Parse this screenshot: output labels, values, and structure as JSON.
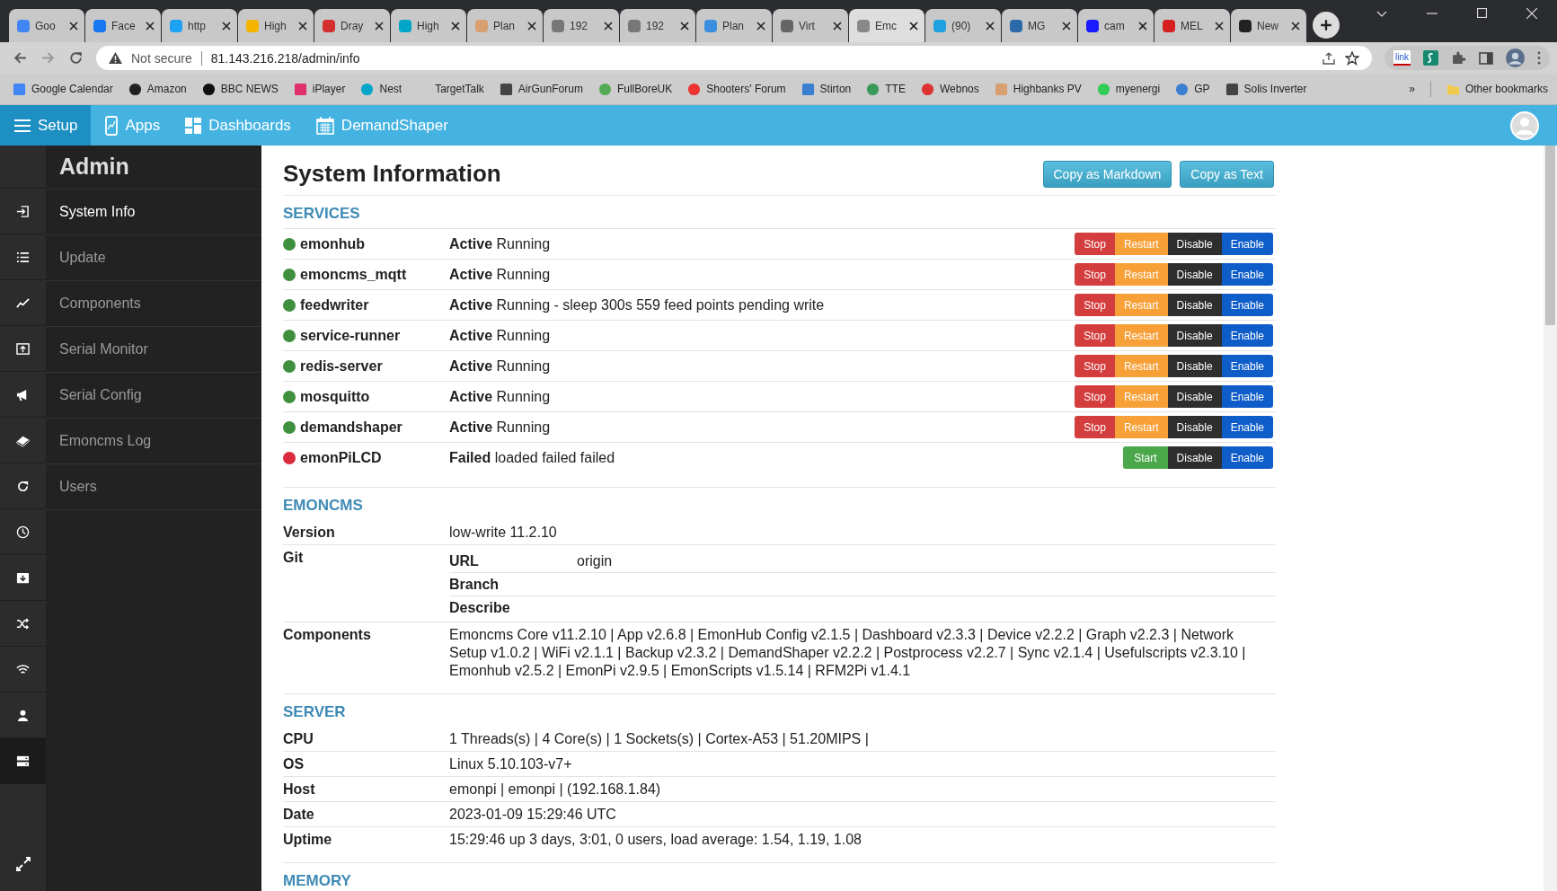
{
  "browser": {
    "tabs": [
      {
        "title": "Goo",
        "selected": false
      },
      {
        "title": "Face",
        "selected": false
      },
      {
        "title": "http",
        "selected": false
      },
      {
        "title": "High",
        "selected": false
      },
      {
        "title": "Dray",
        "selected": false
      },
      {
        "title": "High",
        "selected": false
      },
      {
        "title": "Plan",
        "selected": false
      },
      {
        "title": "192",
        "selected": false
      },
      {
        "title": "192",
        "selected": false
      },
      {
        "title": "Plan",
        "selected": false
      },
      {
        "title": "Virt",
        "selected": false
      },
      {
        "title": "Emc",
        "selected": true
      },
      {
        "title": "(90)",
        "selected": false
      },
      {
        "title": "MG",
        "selected": false
      },
      {
        "title": "cam",
        "selected": false
      },
      {
        "title": "MEL",
        "selected": false
      },
      {
        "title": "New",
        "selected": false
      }
    ],
    "security": "Not secure",
    "url": "81.143.216.218/admin/info",
    "extension_label": "link",
    "bookmarks": [
      "Google Calendar",
      "Amazon",
      "BBC NEWS",
      "iPlayer",
      "Nest",
      "TargetTalk",
      "AirGunForum",
      "FullBoreUK",
      "Shooters' Forum",
      "Stirton",
      "TTE",
      "Webnos",
      "Highbanks PV",
      "myenergi",
      "GP",
      "Solis Inverter"
    ],
    "bookmarks_overflow": "»",
    "other_bookmarks": "Other bookmarks"
  },
  "navbar": {
    "items": [
      {
        "label": "Setup",
        "selected": true
      },
      {
        "label": "Apps",
        "selected": false
      },
      {
        "label": "Dashboards",
        "selected": false
      },
      {
        "label": "DemandShaper",
        "selected": false
      }
    ]
  },
  "sidebar": {
    "title": "Admin",
    "items": [
      {
        "label": "System Info",
        "selected": true
      },
      {
        "label": "Update",
        "selected": false
      },
      {
        "label": "Components",
        "selected": false
      },
      {
        "label": "Serial Monitor",
        "selected": false
      },
      {
        "label": "Serial Config",
        "selected": false
      },
      {
        "label": "Emoncms Log",
        "selected": false
      },
      {
        "label": "Users",
        "selected": false
      }
    ]
  },
  "page": {
    "title": "System Information",
    "buttons": [
      "Copy as Markdown",
      "Copy as Text"
    ],
    "services": {
      "heading": "SERVICES",
      "rows": [
        {
          "name": "emonhub",
          "color": "#3f8f3f",
          "status": "**Active** Running",
          "actions": [
            {
              "label": "Stop",
              "kind": "stop"
            },
            {
              "label": "Restart",
              "kind": "restart"
            },
            {
              "label": "Disable",
              "kind": "disable"
            },
            {
              "label": "Enable",
              "kind": "enable"
            }
          ]
        },
        {
          "name": "emoncms_mqtt",
          "color": "#3f8f3f",
          "status": "**Active** Running",
          "actions": [
            {
              "label": "Stop",
              "kind": "stop"
            },
            {
              "label": "Restart",
              "kind": "restart"
            },
            {
              "label": "Disable",
              "kind": "disable"
            },
            {
              "label": "Enable",
              "kind": "enable"
            }
          ]
        },
        {
          "name": "feedwriter",
          "color": "#3f8f3f",
          "status": "**Active** Running - sleep 300s 559 feed points pending write",
          "actions": [
            {
              "label": "Stop",
              "kind": "stop"
            },
            {
              "label": "Restart",
              "kind": "restart"
            },
            {
              "label": "Disable",
              "kind": "disable"
            },
            {
              "label": "Enable",
              "kind": "enable"
            }
          ]
        },
        {
          "name": "service-runner",
          "color": "#3f8f3f",
          "status": "**Active** Running",
          "actions": [
            {
              "label": "Stop",
              "kind": "stop"
            },
            {
              "label": "Restart",
              "kind": "restart"
            },
            {
              "label": "Disable",
              "kind": "disable"
            },
            {
              "label": "Enable",
              "kind": "enable"
            }
          ]
        },
        {
          "name": "redis-server",
          "color": "#3f8f3f",
          "status": "**Active** Running",
          "actions": [
            {
              "label": "Stop",
              "kind": "stop"
            },
            {
              "label": "Restart",
              "kind": "restart"
            },
            {
              "label": "Disable",
              "kind": "disable"
            },
            {
              "label": "Enable",
              "kind": "enable"
            }
          ]
        },
        {
          "name": "mosquitto",
          "color": "#3f8f3f",
          "status": "**Active** Running",
          "actions": [
            {
              "label": "Stop",
              "kind": "stop"
            },
            {
              "label": "Restart",
              "kind": "restart"
            },
            {
              "label": "Disable",
              "kind": "disable"
            },
            {
              "label": "Enable",
              "kind": "enable"
            }
          ]
        },
        {
          "name": "demandshaper",
          "color": "#3f8f3f",
          "status": "**Active** Running",
          "actions": [
            {
              "label": "Stop",
              "kind": "stop"
            },
            {
              "label": "Restart",
              "kind": "restart"
            },
            {
              "label": "Disable",
              "kind": "disable"
            },
            {
              "label": "Enable",
              "kind": "enable"
            }
          ]
        },
        {
          "name": "emonPiLCD",
          "color": "#dc2b3e",
          "status": "**Failed** loaded failed failed",
          "actions": [
            {
              "label": "Start",
              "kind": "start"
            },
            {
              "label": "Disable",
              "kind": "disable"
            },
            {
              "label": "Enable",
              "kind": "enable"
            }
          ]
        }
      ]
    },
    "emoncms": {
      "heading": "EMONCMS",
      "version_label": "Version",
      "version": "low-write 11.2.10",
      "git_label": "Git",
      "git": [
        {
          "label": "URL",
          "value": "origin"
        },
        {
          "label": "Branch"
        },
        {
          "label": "Describe"
        }
      ],
      "components_label": "Components",
      "components": "Emoncms Core v11.2.10 | App v2.6.8 | EmonHub Config v2.1.5 | Dashboard v2.3.3 | Device v2.2.2 | Graph v2.2.3 | Network Setup v1.0.2 | WiFi v2.1.1 | Backup v2.3.2 | DemandShaper v2.2.2 | Postprocess v2.2.7 | Sync v2.1.4 | Usefulscripts v2.3.10 | Emonhub v2.5.2 | EmonPi v2.9.5 | EmonScripts v1.5.14 | RFM2Pi v1.4.1"
    },
    "server": {
      "heading": "SERVER",
      "rows": [
        {
          "label": "CPU",
          "value": "1 Threads(s) | 4 Core(s) | 1 Sockets(s) | Cortex-A53 | 51.20MIPS |"
        },
        {
          "label": "OS",
          "value": "Linux 5.10.103-v7+"
        },
        {
          "label": "Host",
          "value": "emonpi | emonpi | (192.168.1.84)"
        },
        {
          "label": "Date",
          "value": "2023-01-09 15:29:46 UTC"
        },
        {
          "label": "Uptime",
          "value": "15:29:46 up 3 days, 3:01, 0 users, load average: 1.54, 1.19, 1.08"
        }
      ]
    },
    "memory": {
      "heading": "MEMORY"
    }
  }
}
